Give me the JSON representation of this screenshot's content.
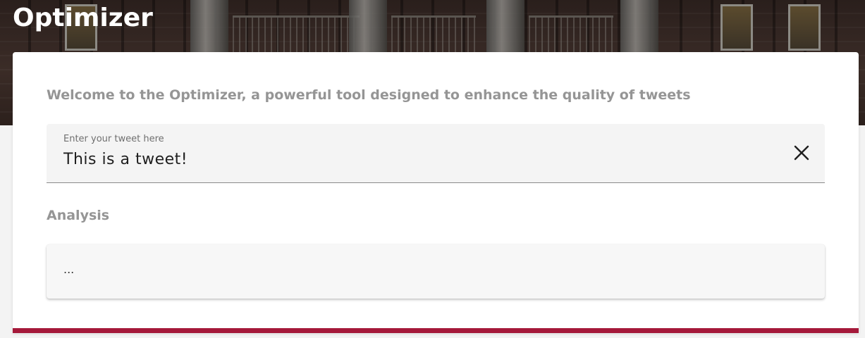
{
  "header": {
    "title": "Optimizer"
  },
  "main": {
    "welcome_text": "Welcome to the Optimizer, a powerful tool designed to enhance the quality of tweets",
    "tweet_input": {
      "label": "Enter your tweet here",
      "value": "This is a tweet!",
      "clear_icon": "close-icon"
    },
    "analysis": {
      "heading": "Analysis",
      "content": "..."
    }
  },
  "colors": {
    "accent_bar": "#a5193a",
    "heading_text": "#959595",
    "input_background": "#f4f4f4",
    "page_background": "#f3f3f3"
  }
}
